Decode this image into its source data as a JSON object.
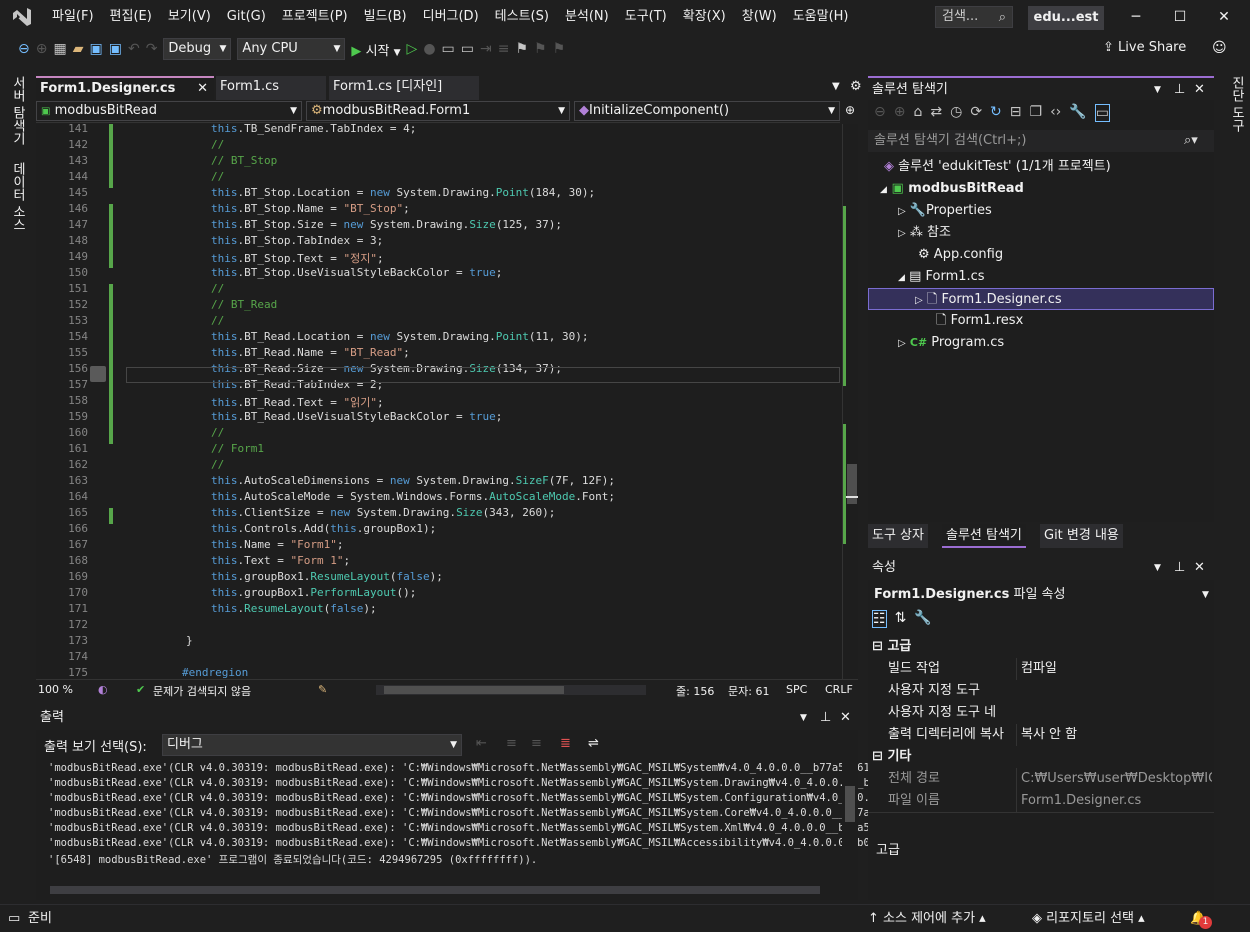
{
  "titlebar": {
    "menus": [
      "파일(F)",
      "편집(E)",
      "보기(V)",
      "Git(G)",
      "프로젝트(P)",
      "빌드(B)",
      "디버그(D)",
      "테스트(S)",
      "분석(N)",
      "도구(T)",
      "확장(X)",
      "창(W)",
      "도움말(H)"
    ],
    "search_placeholder": "검색...",
    "solution_name": "edu...est",
    "minimize": "─",
    "maximize": "☐",
    "close": "✕"
  },
  "toolbar": {
    "config": "Debug",
    "platform": "Any CPU",
    "start_label": "시작",
    "live_share": "Live Share"
  },
  "left_rail": {
    "server_explorer": "서버 탐색기",
    "data_sources": "데이터 소스"
  },
  "right_rail": {
    "diagnostic_tools": "진단 도구"
  },
  "doc_tabs": [
    {
      "label": "Form1.Designer.cs",
      "active": true
    },
    {
      "label": "Form1.cs"
    },
    {
      "label": "Form1.cs [디자인]"
    }
  ],
  "nav": {
    "project": "modbusBitRead",
    "class": "modbusBitRead.Form1",
    "member": "InitializeComponent()"
  },
  "code": [
    {
      "n": "141",
      "t": [
        [
          "kw",
          "this"
        ],
        [
          "",
          "."
        ],
        [
          "",
          "TB_SendFrame.TabIndex = 4;"
        ]
      ]
    },
    {
      "n": "142",
      "t": [
        [
          "cm",
          "//"
        ]
      ]
    },
    {
      "n": "143",
      "t": [
        [
          "cm",
          "// BT_Stop"
        ]
      ]
    },
    {
      "n": "144",
      "t": [
        [
          "cm",
          "//"
        ]
      ]
    },
    {
      "n": "145",
      "t": [
        [
          "kw",
          "this"
        ],
        [
          "",
          ".BT_Stop.Location = "
        ],
        [
          "kw",
          "new"
        ],
        [
          "",
          " System.Drawing."
        ],
        [
          "ty",
          "Point"
        ],
        [
          "",
          "(184, 30);"
        ]
      ]
    },
    {
      "n": "146",
      "t": [
        [
          "kw",
          "this"
        ],
        [
          "",
          ".BT_Stop.Name = "
        ],
        [
          "str",
          "\"BT_Stop\""
        ],
        [
          "",
          ";"
        ]
      ]
    },
    {
      "n": "147",
      "t": [
        [
          "kw",
          "this"
        ],
        [
          "",
          ".BT_Stop.Size = "
        ],
        [
          "kw",
          "new"
        ],
        [
          "",
          " System.Drawing."
        ],
        [
          "ty",
          "Size"
        ],
        [
          "",
          "(125, 37);"
        ]
      ]
    },
    {
      "n": "148",
      "t": [
        [
          "kw",
          "this"
        ],
        [
          "",
          ".BT_Stop.TabIndex = 3;"
        ]
      ]
    },
    {
      "n": "149",
      "t": [
        [
          "kw",
          "this"
        ],
        [
          "",
          ".BT_Stop.Text = "
        ],
        [
          "str",
          "\"정지\""
        ],
        [
          "",
          ";"
        ]
      ]
    },
    {
      "n": "150",
      "t": [
        [
          "kw",
          "this"
        ],
        [
          "",
          ".BT_Stop.UseVisualStyleBackColor = "
        ],
        [
          "kw",
          "true"
        ],
        [
          "",
          ";"
        ]
      ]
    },
    {
      "n": "151",
      "t": [
        [
          "cm",
          "//"
        ]
      ]
    },
    {
      "n": "152",
      "t": [
        [
          "cm",
          "// BT_Read"
        ]
      ]
    },
    {
      "n": "153",
      "t": [
        [
          "cm",
          "//"
        ]
      ]
    },
    {
      "n": "154",
      "t": [
        [
          "kw",
          "this"
        ],
        [
          "",
          ".BT_Read.Location = "
        ],
        [
          "kw",
          "new"
        ],
        [
          "",
          " System.Drawing."
        ],
        [
          "ty",
          "Point"
        ],
        [
          "",
          "(11, 30);"
        ]
      ]
    },
    {
      "n": "155",
      "t": [
        [
          "kw",
          "this"
        ],
        [
          "",
          ".BT_Read.Name = "
        ],
        [
          "str",
          "\"BT_Read\""
        ],
        [
          "",
          ";"
        ]
      ]
    },
    {
      "n": "156",
      "t": [
        [
          "kw",
          "this"
        ],
        [
          "",
          ".BT_Read.Size = "
        ],
        [
          "kw",
          "new"
        ],
        [
          "",
          " System.Drawing."
        ],
        [
          "ty",
          "Size"
        ],
        [
          "",
          "(134, 37);"
        ]
      ]
    },
    {
      "n": "157",
      "t": [
        [
          "kw",
          "this"
        ],
        [
          "",
          ".BT_Read.TabIndex = 2;"
        ]
      ]
    },
    {
      "n": "158",
      "t": [
        [
          "kw",
          "this"
        ],
        [
          "",
          ".BT_Read.Text = "
        ],
        [
          "str",
          "\"읽기\""
        ],
        [
          "",
          ";"
        ]
      ]
    },
    {
      "n": "159",
      "t": [
        [
          "kw",
          "this"
        ],
        [
          "",
          ".BT_Read.UseVisualStyleBackColor = "
        ],
        [
          "kw",
          "true"
        ],
        [
          "",
          ";"
        ]
      ]
    },
    {
      "n": "160",
      "t": [
        [
          "cm",
          "//"
        ]
      ]
    },
    {
      "n": "161",
      "t": [
        [
          "cm",
          "// Form1"
        ]
      ]
    },
    {
      "n": "162",
      "t": [
        [
          "cm",
          "//"
        ]
      ]
    },
    {
      "n": "163",
      "t": [
        [
          "kw",
          "this"
        ],
        [
          "",
          ".AutoScaleDimensions = "
        ],
        [
          "kw",
          "new"
        ],
        [
          "",
          " System.Drawing."
        ],
        [
          "ty",
          "SizeF"
        ],
        [
          "",
          "(7F, 12F);"
        ]
      ]
    },
    {
      "n": "164",
      "t": [
        [
          "kw",
          "this"
        ],
        [
          "",
          ".AutoScaleMode = System.Windows.Forms."
        ],
        [
          "ty",
          "AutoScaleMode"
        ],
        [
          "",
          ".Font;"
        ]
      ]
    },
    {
      "n": "165",
      "t": [
        [
          "kw",
          "this"
        ],
        [
          "",
          ".ClientSize = "
        ],
        [
          "kw",
          "new"
        ],
        [
          "",
          " System.Drawing."
        ],
        [
          "ty",
          "Size"
        ],
        [
          "",
          "(343, 260);"
        ]
      ]
    },
    {
      "n": "166",
      "t": [
        [
          "kw",
          "this"
        ],
        [
          "",
          ".Controls.Add("
        ],
        [
          "kw",
          "this"
        ],
        [
          "",
          ".groupBox1);"
        ]
      ]
    },
    {
      "n": "167",
      "t": [
        [
          "kw",
          "this"
        ],
        [
          "",
          ".Name = "
        ],
        [
          "str",
          "\"Form1\""
        ],
        [
          "",
          ";"
        ]
      ]
    },
    {
      "n": "168",
      "t": [
        [
          "kw",
          "this"
        ],
        [
          "",
          ".Text = "
        ],
        [
          "str",
          "\"Form 1\""
        ],
        [
          "",
          ";"
        ]
      ]
    },
    {
      "n": "169",
      "t": [
        [
          "kw",
          "this"
        ],
        [
          "",
          ".groupBox1."
        ],
        [
          "ty",
          "ResumeLayout"
        ],
        [
          "",
          "("
        ],
        [
          "kw",
          "false"
        ],
        [
          "",
          ");"
        ]
      ]
    },
    {
      "n": "170",
      "t": [
        [
          "kw",
          "this"
        ],
        [
          "",
          ".groupBox1."
        ],
        [
          "ty",
          "PerformLayout"
        ],
        [
          "",
          "();"
        ]
      ]
    },
    {
      "n": "171",
      "t": [
        [
          "kw",
          "this"
        ],
        [
          "",
          "."
        ],
        [
          "ty",
          "ResumeLayout"
        ],
        [
          "",
          "("
        ],
        [
          "kw",
          "false"
        ],
        [
          "",
          ");"
        ]
      ]
    },
    {
      "n": "172",
      "t": []
    },
    {
      "n": "173",
      "t": [
        [
          "",
          "}"
        ]
      ]
    },
    {
      "n": "174",
      "t": []
    },
    {
      "n": "175",
      "t": [
        [
          "kw",
          "#endregion"
        ]
      ]
    }
  ],
  "editor_status": {
    "zoom": "100 %",
    "issues": "문제가 검색되지 않음",
    "line": "줄: 156",
    "col": "문자: 61",
    "spc": "SPC",
    "crlf": "CRLF"
  },
  "output": {
    "title": "출력",
    "show_label": "출력 보기 선택(S):",
    "source": "디버그",
    "lines": [
      "'modbusBitRead.exe'(CLR v4.0.30319: modbusBitRead.exe): 'C:₩Windows₩Microsoft.Net₩assembly₩GAC_MSIL₩System₩v4.0_4.0.0.0__b77a5c56193",
      "'modbusBitRead.exe'(CLR v4.0.30319: modbusBitRead.exe): 'C:₩Windows₩Microsoft.Net₩assembly₩GAC_MSIL₩System.Drawing₩v4.0_4.0.0.0__b03",
      "'modbusBitRead.exe'(CLR v4.0.30319: modbusBitRead.exe): 'C:₩Windows₩Microsoft.Net₩assembly₩GAC_MSIL₩System.Configuration₩v4.0_4.0.0.",
      "'modbusBitRead.exe'(CLR v4.0.30319: modbusBitRead.exe): 'C:₩Windows₩Microsoft.Net₩assembly₩GAC_MSIL₩System.Core₩v4.0_4.0.0.0__b77a5c",
      "'modbusBitRead.exe'(CLR v4.0.30319: modbusBitRead.exe): 'C:₩Windows₩Microsoft.Net₩assembly₩GAC_MSIL₩System.Xml₩v4.0_4.0.0.0__b77a5c5",
      "'modbusBitRead.exe'(CLR v4.0.30319: modbusBitRead.exe): 'C:₩Windows₩Microsoft.Net₩assembly₩GAC_MSIL₩Accessibility₩v4.0_4.0.0.0__b03f",
      "'[6548] modbusBitRead.exe' 프로그램이 종료되었습니다(코드: 4294967295 (0xffffffff))."
    ]
  },
  "solution_explorer": {
    "title": "솔루션 탐색기",
    "search_placeholder": "솔루션 탐색기 검색(Ctrl+;)",
    "items": [
      {
        "label": "솔루션 'edukitTest' (1/1개 프로젝트)"
      },
      {
        "label": "modbusBitRead"
      },
      {
        "label": "Properties"
      },
      {
        "label": "참조"
      },
      {
        "label": "App.config"
      },
      {
        "label": "Form1.cs"
      },
      {
        "label": "Form1.Designer.cs"
      },
      {
        "label": "Form1.resx"
      },
      {
        "label": "Program.cs"
      }
    ]
  },
  "panel_tabs": [
    "도구 상자",
    "솔루션 탐색기",
    "Git 변경 내용"
  ],
  "properties": {
    "title": "속성",
    "object": "Form1.Designer.cs",
    "object_kind": "파일 속성",
    "cat_advanced": "고급",
    "cat_misc": "기타",
    "rows": [
      {
        "k": "빌드 작업",
        "v": "컴파일"
      },
      {
        "k": "사용자 지정 도구",
        "v": ""
      },
      {
        "k": "사용자 지정 도구 네",
        "v": ""
      },
      {
        "k": "출력 디렉터리에 복사",
        "v": "복사 안 함"
      }
    ],
    "misc_rows": [
      {
        "k": "전체 경로",
        "v": "C:₩Users₩user₩Desktop₩IOT₩"
      },
      {
        "k": "파일 이름",
        "v": "Form1.Designer.cs"
      }
    ],
    "desc": "고급"
  },
  "statusbar": {
    "ready": "준비",
    "source_control": "소스 제어에 추가",
    "repo": "리포지토리 선택",
    "notif_count": "1"
  }
}
